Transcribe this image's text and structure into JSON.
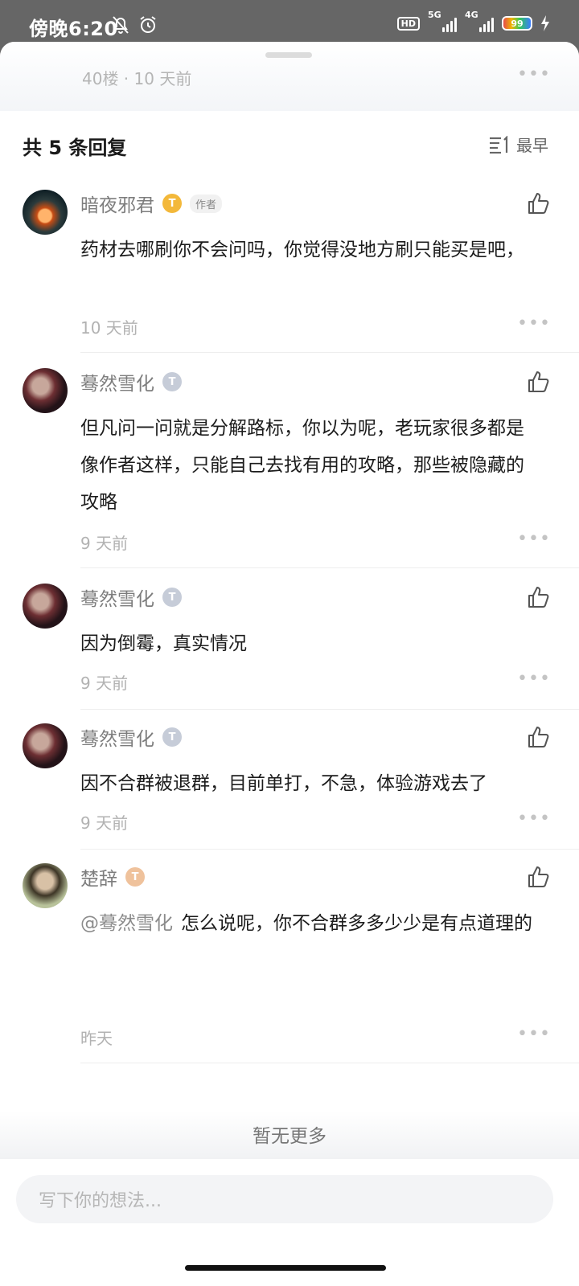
{
  "status_bar": {
    "time": "傍晚6:20",
    "hd": "HD",
    "net1": "5G",
    "net2": "4G",
    "battery": "99"
  },
  "post": {
    "floor_info": "40楼 · 10 天前"
  },
  "replies": {
    "count_label": "共 5 条回复",
    "sort_label": "最早",
    "items": [
      {
        "user": "暗夜邪君",
        "level": "T",
        "author_tag": "作者",
        "text": "药材去哪刷你不会问吗，你觉得没地方刷只能买是吧，",
        "time": "10 天前"
      },
      {
        "user": "蓦然雪化",
        "level": "T",
        "text": "但凡问一问就是分解路标，你以为呢，老玩家很多都是像作者这样，只能自己去找有用的攻略，那些被隐藏的攻略",
        "time": "9 天前"
      },
      {
        "user": "蓦然雪化",
        "level": "T",
        "text": "因为倒霉，真实情况",
        "time": "9 天前"
      },
      {
        "user": "蓦然雪化",
        "level": "T",
        "text": "因不合群被退群，目前单打，不急，体验游戏去了",
        "time": "9 天前"
      },
      {
        "user": "楚辞",
        "level": "T",
        "mention": "@蓦然雪化",
        "text": "怎么说呢，你不合群多多少少是有点道理的",
        "time": "昨天"
      }
    ]
  },
  "footer": {
    "no_more": "暂无更多",
    "input_placeholder": "写下你的想法..."
  }
}
